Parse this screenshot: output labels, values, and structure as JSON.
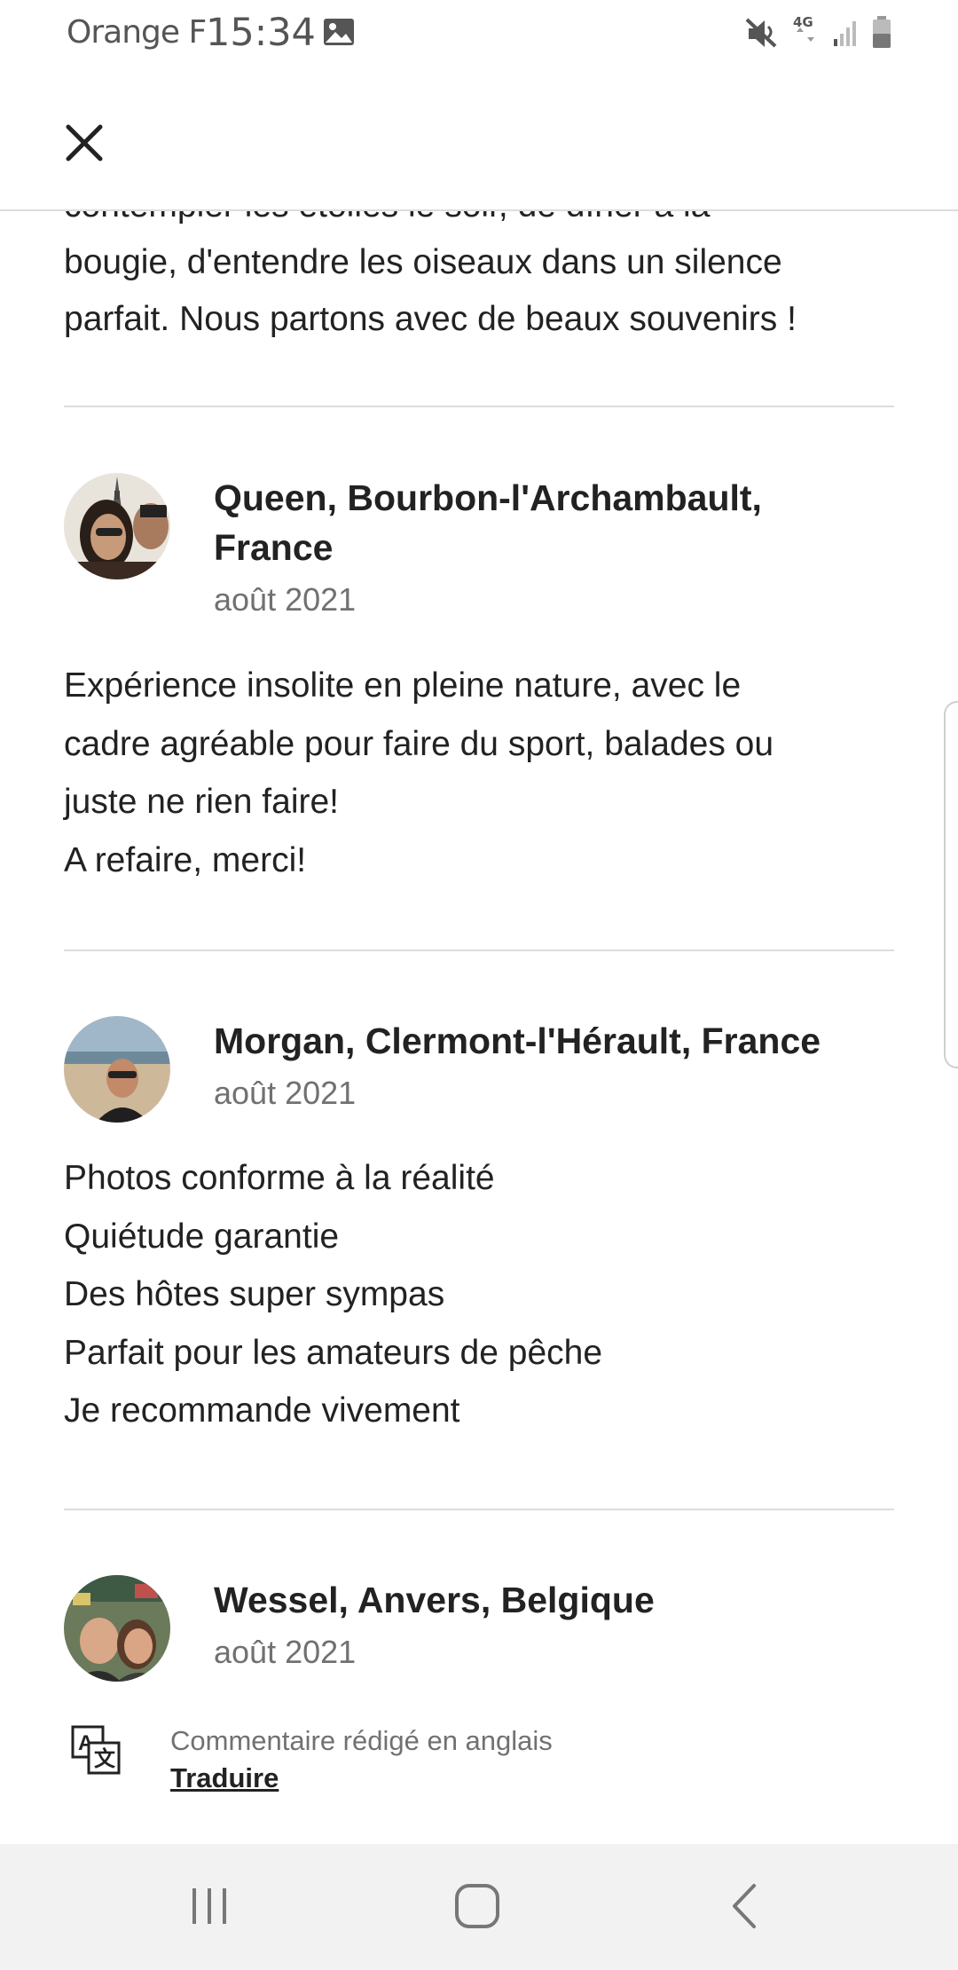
{
  "status_bar": {
    "carrier": "Orange F",
    "time": "15:34",
    "icons": [
      "image-icon",
      "mute-icon",
      "4g-icon",
      "signal-icon",
      "battery-icon"
    ],
    "network": "4G"
  },
  "header": {
    "close_icon": "close-icon"
  },
  "partial_review": {
    "lines": [
      "contempler les étoiles le soir, de dîner à la",
      "bougie, d'entendre les oiseaux dans un silence",
      "parfait. Nous partons avec de beaux souvenirs !"
    ]
  },
  "reviews": [
    {
      "name": "Queen, Bourbon-l'Archambault, France",
      "date": "août 2021",
      "lines": [
        "Expérience insolite en pleine nature, avec le",
        "cadre agréable pour faire du sport, balades ou",
        "juste ne rien faire!",
        "A refaire, merci!"
      ]
    },
    {
      "name": "Morgan, Clermont-l'Hérault, France",
      "date": "août 2021",
      "lines": [
        "Photos conforme à la réalité",
        "Quiétude garantie",
        "Des hôtes super sympas",
        "Parfait pour les amateurs de pêche",
        "Je recommande vivement"
      ]
    },
    {
      "name": "Wessel, Anvers, Belgique",
      "date": "août 2021",
      "translation_note": "Commentaire rédigé en anglais",
      "translate_label": "Traduire"
    }
  ],
  "nav_bar": {
    "icons": [
      "recent-apps-icon",
      "home-icon",
      "back-icon"
    ]
  },
  "colors": {
    "text": "#222222",
    "muted": "#717171",
    "divider": "#dddddd",
    "nav_bg": "#f2f2f2"
  }
}
